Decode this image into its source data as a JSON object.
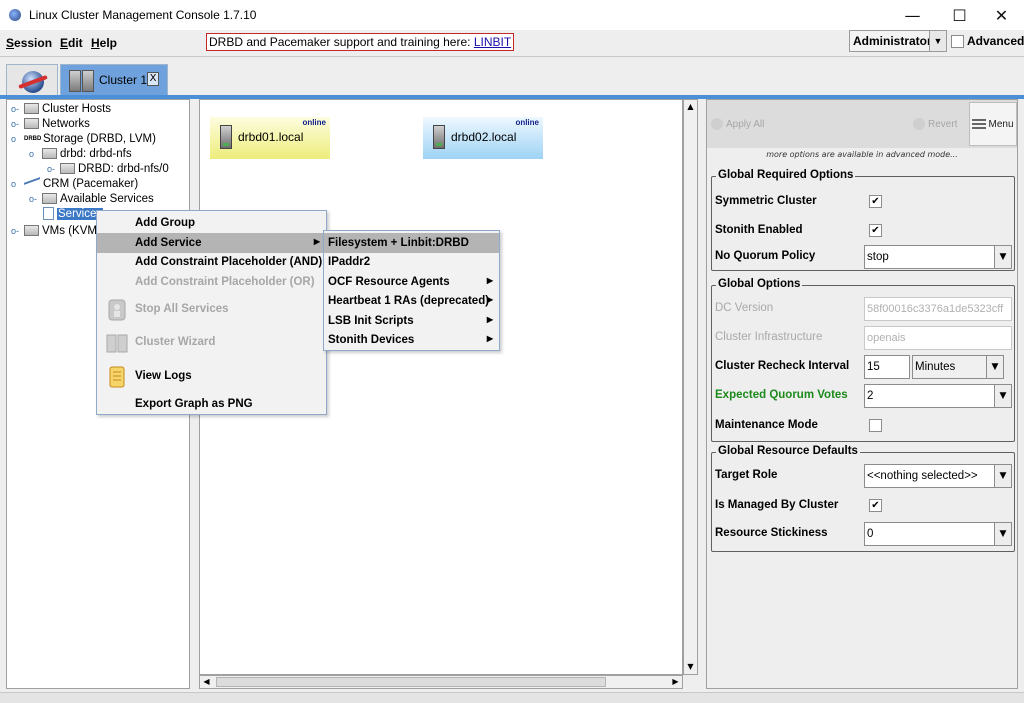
{
  "window": {
    "title": "Linux Cluster Management Console 1.7.10",
    "minimize": "—",
    "maximize": "☐",
    "close": "✕"
  },
  "menubar": {
    "session": "Session",
    "edit": "Edit",
    "help": "Help",
    "promo_text": "DRBD and Pacemaker support and training here: ",
    "promo_link": "LINBIT",
    "user": "Administrator",
    "advanced_label": "Advanced",
    "advanced_checked": false
  },
  "tabs": {
    "cluster_label": "Cluster 1",
    "cluster_close": "X"
  },
  "tree": {
    "cluster_hosts": "Cluster Hosts",
    "networks": "Networks",
    "storage": "Storage (DRBD, LVM)",
    "drbd_resource": "drbd: drbd-nfs",
    "drbd_volume": "DRBD: drbd-nfs/0",
    "crm": "CRM (Pacemaker)",
    "available_services": "Available Services",
    "services": "Services",
    "vms": "VMs (KVM,"
  },
  "graph": {
    "hosts": [
      {
        "name": "drbd01.local",
        "status": "online",
        "color": "#eded7a"
      },
      {
        "name": "drbd02.local",
        "status": "online",
        "color": "#9ed3f5"
      }
    ]
  },
  "context_menu": {
    "add_group": "Add Group",
    "add_service": "Add Service",
    "add_constraint_and": "Add Constraint Placeholder (AND)",
    "add_constraint_or": "Add Constraint Placeholder (OR)",
    "stop_all": "Stop All Services",
    "cluster_wizard": "Cluster Wizard",
    "view_logs": "View Logs",
    "export_png": "Export Graph as PNG"
  },
  "submenu": {
    "filesystem": "Filesystem + Linbit:DRBD",
    "ipaddr2": "IPaddr2",
    "ocf": "OCF Resource Agents",
    "heartbeat": "Heartbeat 1 RAs (deprecated)",
    "lsb": "LSB Init Scripts",
    "stonith": "Stonith Devices"
  },
  "right_panel": {
    "apply_all": "Apply All",
    "revert": "Revert",
    "menu": "Menu",
    "advanced_note": "more options are available in advanced mode...",
    "global_required": {
      "title": "Global Required Options",
      "symmetric_cluster": "Symmetric Cluster",
      "symmetric_cluster_checked": true,
      "stonith_enabled": "Stonith Enabled",
      "stonith_enabled_checked": true,
      "no_quorum_policy": "No Quorum Policy",
      "no_quorum_policy_value": "stop"
    },
    "global_options": {
      "title": "Global Options",
      "dc_version": "DC Version",
      "dc_version_value": "58f00016c3376a1de5323cff",
      "cluster_infrastructure": "Cluster Infrastructure",
      "cluster_infrastructure_value": "openais",
      "cluster_recheck_interval": "Cluster Recheck Interval",
      "cluster_recheck_value": "15",
      "cluster_recheck_unit": "Minutes",
      "expected_quorum_votes": "Expected Quorum Votes",
      "expected_quorum_votes_value": "2",
      "maintenance_mode": "Maintenance Mode",
      "maintenance_mode_checked": false
    },
    "global_resource_defaults": {
      "title": "Global Resource Defaults",
      "target_role": "Target Role",
      "target_role_value": "<<nothing selected>>",
      "is_managed": "Is Managed By Cluster",
      "is_managed_checked": true,
      "resource_stickiness": "Resource Stickiness",
      "resource_stickiness_value": "0"
    }
  },
  "colors": {
    "accent": "#4a90d9",
    "selection": "#3b78c5",
    "label_green": "#1b8a1b"
  }
}
